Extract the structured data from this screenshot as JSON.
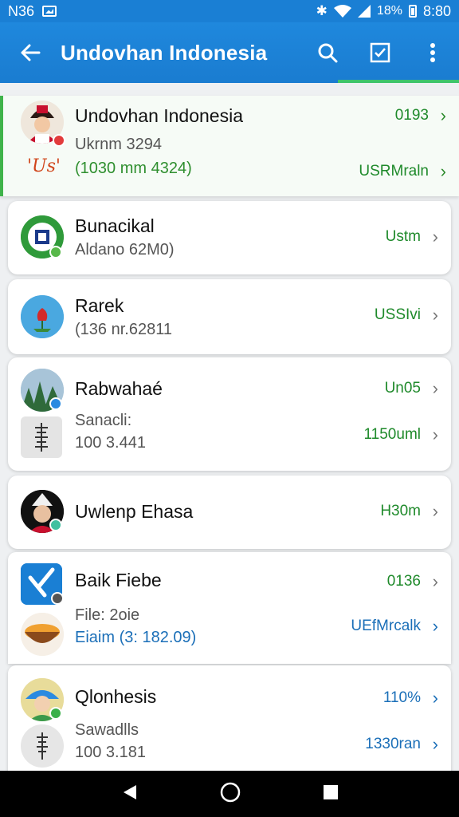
{
  "status": {
    "left_text": "N36",
    "time": "8:80",
    "battery": "18%"
  },
  "appbar": {
    "title": "Undovhan Indonesia"
  },
  "items": [
    {
      "name": "Undovhan Indonesia",
      "sub1": "Ukrnm 3294",
      "sub2": "(1030 mm 4324)",
      "logo_text": "'Us'",
      "val1": "0193",
      "val2": "USRMraln"
    },
    {
      "name": "Bunacikal",
      "sub1": "Aldano 62M0)",
      "val1": "Ustm"
    },
    {
      "name": "Rarek",
      "sub1": "(136 nr.62811",
      "val1": "USSIvi"
    },
    {
      "name": "Rabwahaé",
      "sub1": "Sanacli:",
      "sub2": "100 3.441",
      "val1": "Un05",
      "val2": "1150uml"
    },
    {
      "name": "Uwlenp Ehasa",
      "val1": "H30m"
    },
    {
      "name": "Baik Fiebe",
      "sub1": "File: 2oie",
      "sub2": "Eiaim (3: 182.09)",
      "val1": "0136",
      "val2": "UEfMrcalk"
    },
    {
      "name": "Qlonhesis",
      "sub1": "Sawadlls",
      "sub2": "100 3.181",
      "val1": "110%",
      "val2": "1330ran"
    }
  ],
  "icons": {
    "back": "arrow-left-icon",
    "search": "search-icon",
    "check": "checkbox-icon",
    "more": "more-vert-icon"
  },
  "colors": {
    "primary": "#1a7fd4",
    "accent": "#3fb34a",
    "value_green": "#1f8a2b",
    "value_blue": "#1b6fb8"
  }
}
